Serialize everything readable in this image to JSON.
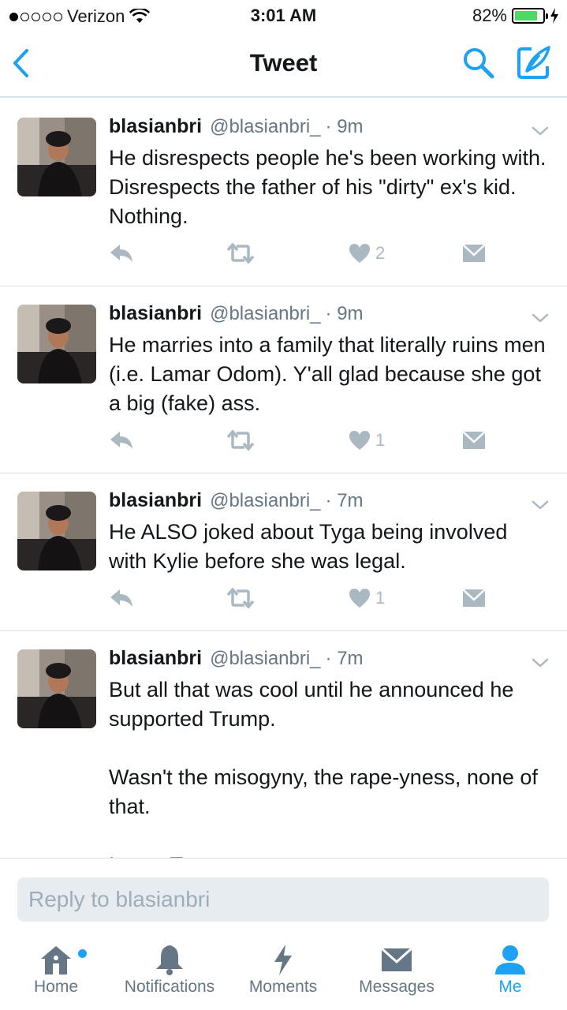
{
  "status_bar": {
    "carrier": "Verizon",
    "time": "3:01 AM",
    "battery": "82%",
    "battery_level": 0.82
  },
  "nav": {
    "title": "Tweet"
  },
  "tweets": [
    {
      "author": "blasianbri",
      "handle": "@blasianbri_",
      "time": "· 9m",
      "text": "He disrespects people he's been working with. Disrespects the father of his \"dirty\" ex's kid. Nothing.",
      "likes": "2"
    },
    {
      "author": "blasianbri",
      "handle": "@blasianbri_",
      "time": "· 9m",
      "text": "He marries into a family that literally ruins men (i.e. Lamar Odom). Y'all glad because she got a big (fake) ass.",
      "likes": "1"
    },
    {
      "author": "blasianbri",
      "handle": "@blasianbri_",
      "time": "· 7m",
      "text": "He ALSO joked about Tyga being involved with Kylie before she was legal.",
      "likes": "1"
    },
    {
      "author": "blasianbri",
      "handle": "@blasianbri_",
      "time": "· 7m",
      "text": "But all that was cool until he announced he supported Trump.\n\nWasn't the misogyny, the rape-yness, none of that.\n\nIt was Trump.",
      "likes": ""
    }
  ],
  "reply": {
    "placeholder": "Reply to blasianbri"
  },
  "tabs": [
    {
      "label": "Home",
      "icon": "home-icon"
    },
    {
      "label": "Notifications",
      "icon": "bell-icon"
    },
    {
      "label": "Moments",
      "icon": "lightning-icon"
    },
    {
      "label": "Messages",
      "icon": "envelope-icon"
    },
    {
      "label": "Me",
      "icon": "person-icon"
    }
  ],
  "colors": {
    "accent": "#1da1f2",
    "muted": "#657786",
    "action_gray": "#aab8c2"
  }
}
